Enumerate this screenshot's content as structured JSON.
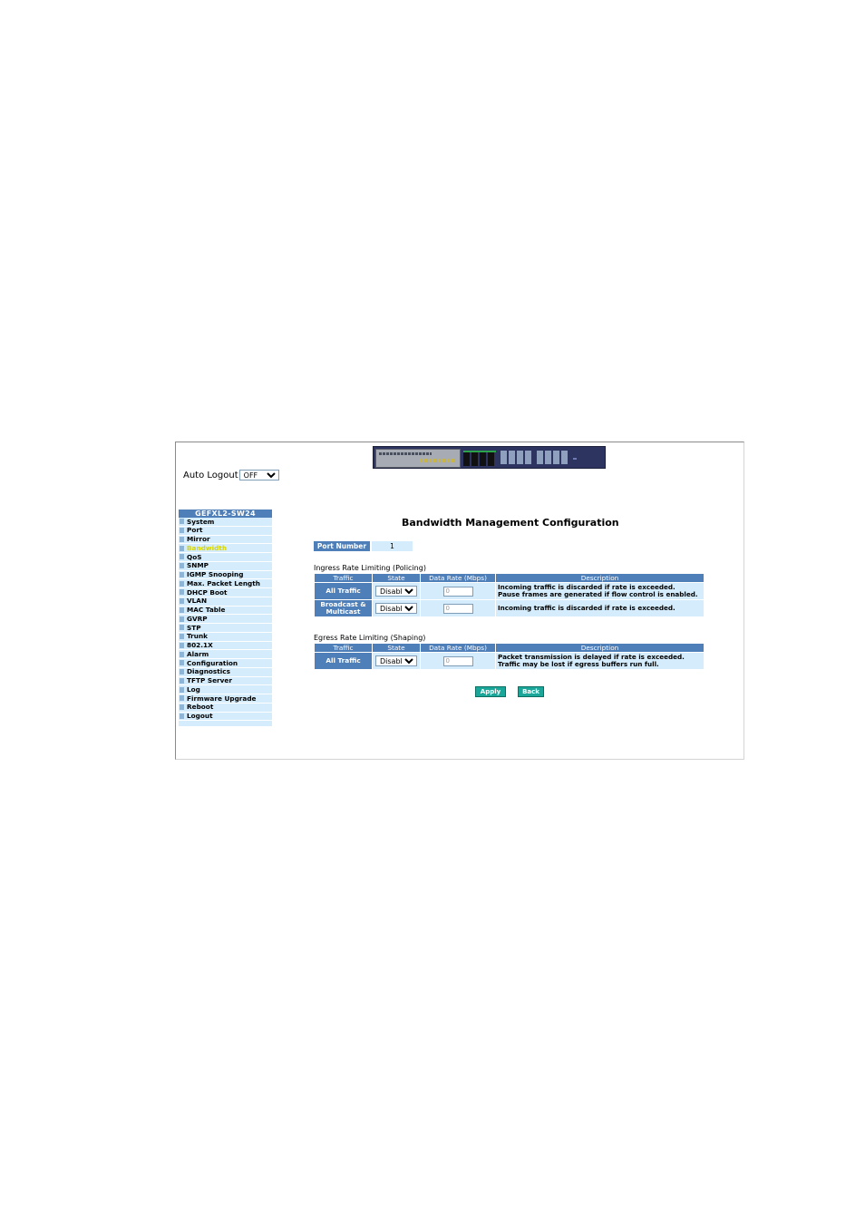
{
  "header": {
    "auto_logout_label": "Auto Logout",
    "auto_logout_value": "OFF"
  },
  "sidebar": {
    "title": "GEFXL2-SW24",
    "items": [
      {
        "label": "System"
      },
      {
        "label": "Port"
      },
      {
        "label": "Mirror"
      },
      {
        "label": "Bandwidth",
        "active": true
      },
      {
        "label": "QoS"
      },
      {
        "label": "SNMP"
      },
      {
        "label": "IGMP Snooping"
      },
      {
        "label": "Max. Packet Length"
      },
      {
        "label": "DHCP Boot"
      },
      {
        "label": "VLAN"
      },
      {
        "label": "MAC Table"
      },
      {
        "label": "GVRP"
      },
      {
        "label": "STP"
      },
      {
        "label": "Trunk"
      },
      {
        "label": "802.1X"
      },
      {
        "label": "Alarm"
      },
      {
        "label": "Configuration"
      },
      {
        "label": "Diagnostics"
      },
      {
        "label": "TFTP Server"
      },
      {
        "label": "Log"
      },
      {
        "label": "Firmware Upgrade"
      },
      {
        "label": "Reboot"
      },
      {
        "label": "Logout"
      }
    ]
  },
  "main": {
    "title": "Bandwidth Management Configuration",
    "port_number_label": "Port Number",
    "port_number_value": "1",
    "columns": {
      "traffic": "Traffic",
      "state": "State",
      "rate": "Data Rate (Mbps)",
      "description": "Description"
    },
    "ingress": {
      "title": "Ingress Rate Limiting (Policing)",
      "rows": [
        {
          "traffic": "All Traffic",
          "state": "Disable",
          "rate": "0",
          "desc1": "Incoming traffic is discarded if rate is exceeded.",
          "desc2": "Pause frames are generated if flow control is enabled."
        },
        {
          "traffic1": "Broadcast &",
          "traffic2": "Multicast",
          "state": "Disable",
          "rate": "0",
          "desc1": "Incoming traffic is discarded if rate is exceeded."
        }
      ]
    },
    "egress": {
      "title": "Egress Rate Limiting (Shaping)",
      "rows": [
        {
          "traffic": "All Traffic",
          "state": "Disable",
          "rate": "0",
          "desc1": "Packet transmission is delayed if rate is exceeded.",
          "desc2": "Traffic may be lost if egress buffers run full."
        }
      ]
    },
    "apply_label": "Apply",
    "back_label": "Back"
  },
  "colors": {
    "header_blue": "#4f7fb8",
    "cell_light": "#d4ecfb",
    "button_teal": "#1aa79a",
    "active_menu": "#d6d60a"
  }
}
